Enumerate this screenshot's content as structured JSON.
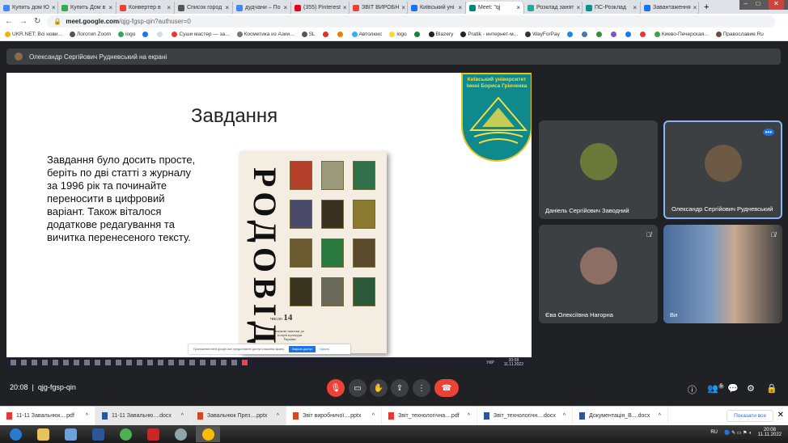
{
  "browser": {
    "tabs": [
      {
        "label": "Купить дом Ю",
        "color": "#4285f4"
      },
      {
        "label": "Купить Дом в",
        "color": "#34a853"
      },
      {
        "label": "Конвертер в",
        "color": "#ea4335"
      },
      {
        "label": "Список город",
        "color": "#555555"
      },
      {
        "label": "дудчани – По",
        "color": "#4285f4"
      },
      {
        "label": "(355) Pinterest",
        "color": "#e60023"
      },
      {
        "label": "ЗВІТ ВИРОБН",
        "color": "#ea4335"
      },
      {
        "label": "Київський уні",
        "color": "#1a73e8"
      },
      {
        "label": "Meet: \"qj",
        "color": "#00897b",
        "active": true
      },
      {
        "label": "Розклад занят",
        "color": "#26a69a"
      },
      {
        "label": "ПС-Розклад",
        "color": "#009688"
      },
      {
        "label": "Завантаження",
        "color": "#1a73e8"
      }
    ],
    "url_host": "meet.google.com",
    "url_path": "/qjg-fgsp-qin?authuser=0",
    "bookmarks": [
      "UKR.NET: Всі нови...",
      "Логотип Zoom",
      "logo",
      "",
      "",
      "Суши мастер — за...",
      "Косметика из Азии...",
      "SL",
      "",
      "",
      "Автолюкс",
      "logo",
      "",
      "Blazery",
      "Pratik - интернет-м...",
      "WayForPay",
      "",
      "",
      "",
      "",
      "",
      "",
      "Киево-Печерская...",
      "Православие.Ru"
    ]
  },
  "meet": {
    "banner": "Олександр Сергійович Рудневський на екрані",
    "slide": {
      "title": "Завдання",
      "text": "Завдання було досить просте, беріть по дві статті з журналу за 1996 рік та починайте переносити в цифровий варіант. Також віталося додаткове редагування та вичитка перенесеного тексту.",
      "book_title": "РОДОВІД",
      "book_number_label": "число",
      "book_number": "14",
      "book_subtitle": "наукові записки до історії культури України",
      "logo_text": "Київський університет імені Бориса Грінченка",
      "share_notice": "Приложение meet.google.com предоставлен доступ к вашему экрану.",
      "share_stop": "Закрыть доступ",
      "share_hide": "Скрыть",
      "inner_time": "20:08",
      "inner_date": "11.11.2022",
      "inner_lang": "УКР"
    },
    "participants": [
      {
        "name": "Даніель Сергійович Заводний",
        "muted": false,
        "color": "#6b7a3a"
      },
      {
        "name": "Олександр Сергійович Рудневський",
        "muted": false,
        "color": "#6d5a45",
        "speaking": true
      },
      {
        "name": "Єва Олексіївна Нагорна",
        "muted": true,
        "color": "#8d6e63"
      },
      {
        "name": "Ви",
        "muted": true,
        "color": "#4a6a9a"
      }
    ],
    "time": "20:08",
    "meeting_code": "qjg-fgsp-qin",
    "participant_count": "5",
    "accent": "#8ab4f8",
    "end_color": "#ea4335"
  },
  "downloads": {
    "items": [
      {
        "label": "11-11 Завальнюк....pdf",
        "type": "pdf"
      },
      {
        "label": "11-11 Завальню....docx",
        "type": "docx"
      },
      {
        "label": "Завальнюк През....pptx",
        "type": "pptx"
      },
      {
        "label": "Звіт виробничої....pptx",
        "type": "pptx"
      },
      {
        "label": "Звіт_технологічна....pdf",
        "type": "pdf"
      },
      {
        "label": "Звіт_технологічн....docx",
        "type": "docx"
      },
      {
        "label": "Документація_В....docx",
        "type": "docx"
      }
    ],
    "show_all": "Показати все"
  },
  "taskbar": {
    "lang": "RU",
    "time": "20:08",
    "date": "11.11.2022"
  }
}
